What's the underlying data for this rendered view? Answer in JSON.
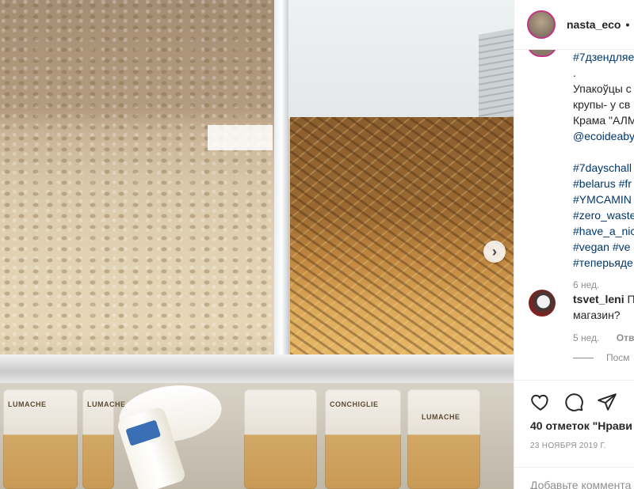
{
  "post": {
    "username": "nasta_eco",
    "separator": "•",
    "next_label": "›"
  },
  "caption": {
    "line1": "#7дзендляе",
    "line2": ".",
    "line3": "Упакоўцы с",
    "line4": "крупы- у св",
    "line5": "Крама \"АЛМ",
    "line6": "@ecoideaby",
    "tags": [
      "#7dayschall",
      "#belarus #fr",
      "#YMCAMIN",
      "#zero_waste",
      "#have_a_nic",
      "#vegan #ve",
      "#теперьяде"
    ],
    "time": "6 нед."
  },
  "comment": {
    "user": "tsvet_leni",
    "text1": "П",
    "text2": "магазин?",
    "time": "5 нед.",
    "reply": "Отве",
    "replies": "Посм"
  },
  "photo": {
    "pack_labels": [
      "LUMACHE",
      "LUMACHE",
      "CONCHIGLIE",
      "LUMACHE"
    ]
  },
  "footer": {
    "likes": "40 отметок \"Нрави",
    "date": "23 НОЯБРЯ 2019 Г.",
    "add_comment": "Добавьте коммента"
  },
  "colors": {
    "link": "#00376b",
    "muted": "#8e8e8e",
    "text": "#262626",
    "story_ring": "#c13584"
  },
  "icons": [
    "heart-icon",
    "comment-icon",
    "share-icon"
  ]
}
